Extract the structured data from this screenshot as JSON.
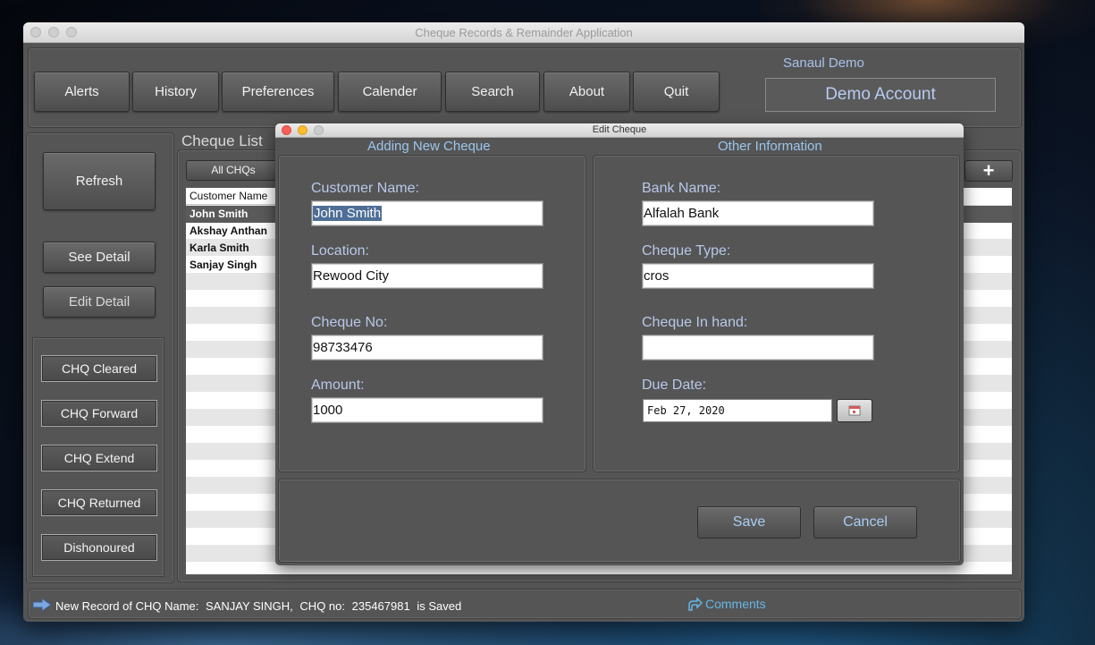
{
  "window": {
    "title": "Cheque Records & Remainder Application"
  },
  "toolbar": {
    "buttons": [
      "Alerts",
      "History",
      "Preferences",
      "Calender",
      "Search",
      "About",
      "Quit"
    ]
  },
  "account": {
    "user": "Sanaul Demo",
    "name": "Demo Account"
  },
  "sidebar": {
    "refresh": "Refresh",
    "see_detail": "See Detail",
    "edit_detail": "Edit Detail",
    "status_buttons": [
      "CHQ Cleared",
      "CHQ Forward",
      "CHQ Extend",
      "CHQ Returned",
      "Dishonoured"
    ]
  },
  "list": {
    "title": "Cheque List",
    "filter": "All CHQs",
    "add_icon": "+",
    "column_header": "Customer Name",
    "rows": [
      "John Smith",
      "Akshay Anthan",
      "Karla Smith",
      "Sanjay Singh"
    ]
  },
  "status": {
    "message": "New Record of CHQ Name:",
    "name": "SANJAY SINGH,",
    "chq_label": "CHQ no:",
    "chq_no": "235467981",
    "suffix": "is Saved",
    "comments": "Comments"
  },
  "dialog": {
    "title": "Edit Cheque",
    "left_title": "Adding New Cheque",
    "right_title": "Other Information",
    "fields": {
      "customer_name": {
        "label": "Customer Name:",
        "value": "John Smith"
      },
      "location": {
        "label": "Location:",
        "value": "Rewood City"
      },
      "cheque_no": {
        "label": "Cheque No:",
        "value": "98733476"
      },
      "amount": {
        "label": "Amount:",
        "value": "1000"
      },
      "bank_name": {
        "label": "Bank Name:",
        "value": "Alfalah Bank"
      },
      "cheque_type": {
        "label": "Cheque Type:",
        "value": "cros"
      },
      "cheque_in_hand": {
        "label": "Cheque In hand:",
        "value": ""
      },
      "due_date": {
        "label": "Due Date:",
        "value": "Feb 27, 2020"
      }
    },
    "save": "Save",
    "cancel": "Cancel"
  }
}
